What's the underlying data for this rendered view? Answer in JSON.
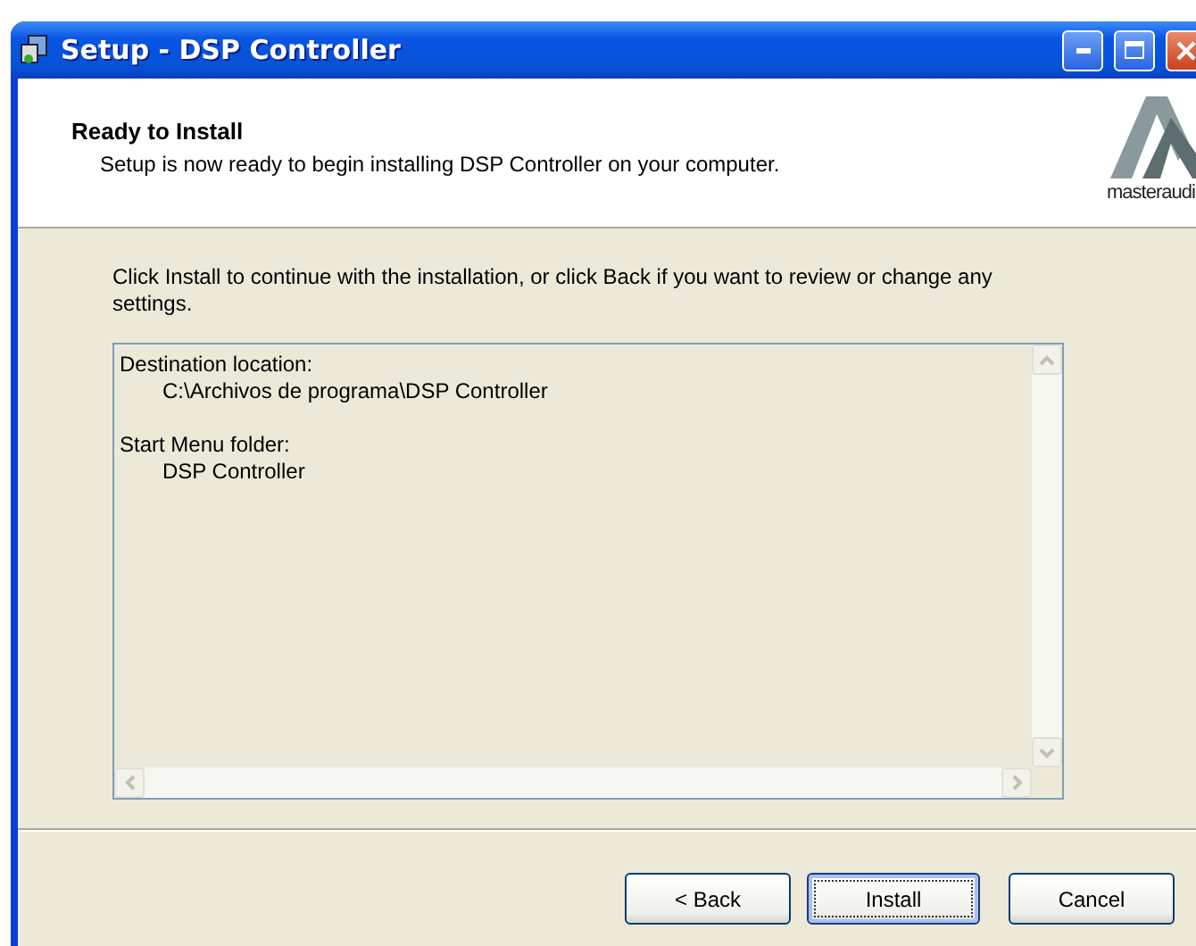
{
  "window": {
    "title": "Setup - DSP Controller"
  },
  "header": {
    "title": "Ready to Install",
    "subtitle": "Setup is now ready to begin installing DSP Controller on your computer.",
    "logo_text": "masteraudi"
  },
  "instructions": "Click Install to continue with the installation, or click Back if you want to review or change any settings.",
  "summary": [
    {
      "label": "Destination location:",
      "value": "C:\\Archivos de programa\\DSP Controller"
    },
    {
      "label": "Start Menu folder:",
      "value": "DSP Controller"
    }
  ],
  "buttons": [
    {
      "label": "< Back",
      "focused": false
    },
    {
      "label": "Install",
      "focused": true
    },
    {
      "label": "Cancel",
      "focused": false
    }
  ]
}
